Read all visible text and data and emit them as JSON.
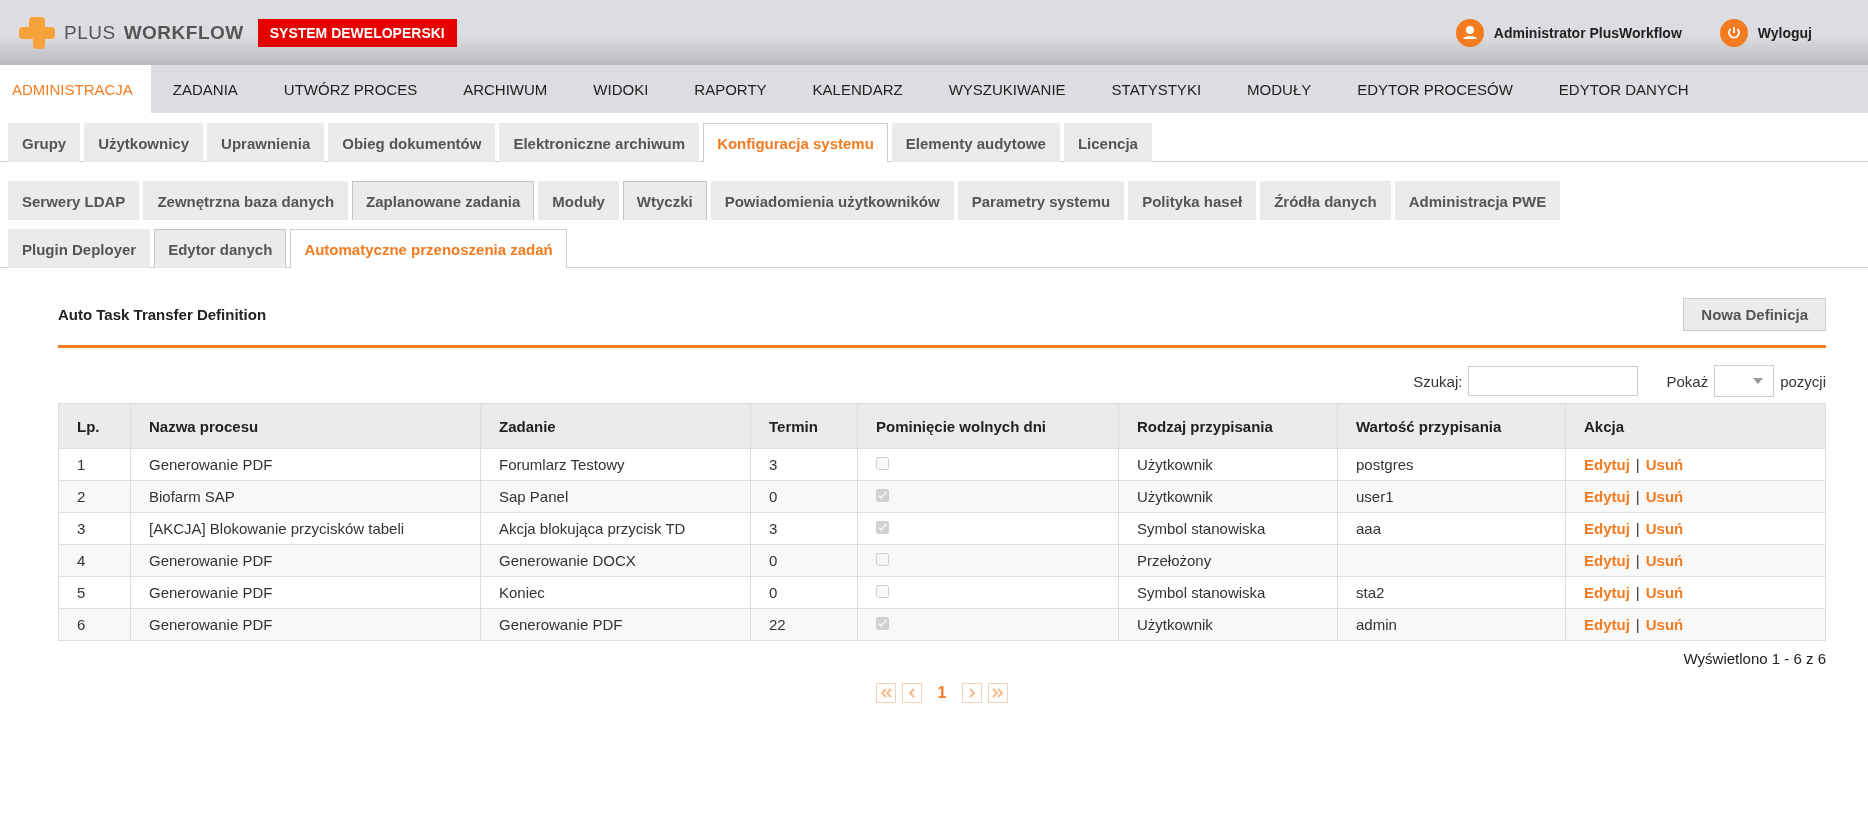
{
  "header": {
    "logo": {
      "part_1": "PLUS",
      "part_2": "WORKFLOW"
    },
    "environment_badge": "SYSTEM DEWELOPERSKI",
    "user": "Administrator PlusWorkflow",
    "logout": "Wyloguj"
  },
  "main_menu": [
    {
      "label": "ADMINISTRACJA",
      "selected": true
    },
    {
      "label": "ZADANIA",
      "selected": false
    },
    {
      "label": "UTWÓRZ PROCES",
      "selected": false
    },
    {
      "label": "ARCHIWUM",
      "selected": false
    },
    {
      "label": "WIDOKI",
      "selected": false
    },
    {
      "label": "RAPORTY",
      "selected": false
    },
    {
      "label": "KALENDARZ",
      "selected": false
    },
    {
      "label": "WYSZUKIWANIE",
      "selected": false
    },
    {
      "label": "STATYSTYKI",
      "selected": false
    },
    {
      "label": "MODUŁY",
      "selected": false
    },
    {
      "label": "EDYTOR PROCESÓW",
      "selected": false
    },
    {
      "label": "EDYTOR DANYCH",
      "selected": false
    }
  ],
  "admin_tabs": [
    {
      "label": "Grupy",
      "selected": false
    },
    {
      "label": "Użytkownicy",
      "selected": false
    },
    {
      "label": "Uprawnienia",
      "selected": false
    },
    {
      "label": "Obieg dokumentów",
      "selected": false
    },
    {
      "label": "Elektroniczne archiwum",
      "selected": false
    },
    {
      "label": "Konfiguracja systemu",
      "selected": true
    },
    {
      "label": "Elementy audytowe",
      "selected": false
    },
    {
      "label": "Licencja",
      "selected": false
    }
  ],
  "config_tabs": [
    [
      {
        "label": "Serwery LDAP",
        "selected": false,
        "outlined": false
      },
      {
        "label": "Zewnętrzna baza danych",
        "selected": false,
        "outlined": false
      },
      {
        "label": "Zaplanowane zadania",
        "selected": false,
        "outlined": true
      },
      {
        "label": "Moduły",
        "selected": false,
        "outlined": false
      },
      {
        "label": "Wtyczki",
        "selected": false,
        "outlined": true
      },
      {
        "label": "Powiadomienia użytkowników",
        "selected": false,
        "outlined": false
      },
      {
        "label": "Parametry systemu",
        "selected": false,
        "outlined": false
      },
      {
        "label": "Polityka haseł",
        "selected": false,
        "outlined": false
      },
      {
        "label": "Źródła danych",
        "selected": false,
        "outlined": false
      },
      {
        "label": "Administracja PWE",
        "selected": false,
        "outlined": false
      }
    ],
    [
      {
        "label": "Plugin Deployer",
        "selected": false,
        "outlined": false
      },
      {
        "label": "Edytor danych",
        "selected": false,
        "outlined": true
      },
      {
        "label": "Automatyczne przenoszenia zadań",
        "selected": true,
        "outlined": false
      }
    ]
  ],
  "panel": {
    "title": "Auto Task Transfer Definition",
    "new_button": "Nowa Definicja"
  },
  "filters": {
    "search_label": "Szukaj:",
    "show_label": "Pokaż",
    "show_suffix": "pozycji"
  },
  "table": {
    "columns": [
      "Lp.",
      "Nazwa procesu",
      "Zadanie",
      "Termin",
      "Pominięcie wolnych dni",
      "Rodzaj przypisania",
      "Wartość przypisania",
      "Akcja"
    ],
    "rows": [
      {
        "lp": "1",
        "process": "Generowanie PDF",
        "task": "Forumlarz Testowy",
        "deadline": "3",
        "skip_free_days": false,
        "assignment_type": "Użytkownik",
        "assignment_value": "postgres",
        "edit": "Edytuj",
        "separator": "|",
        "delete": "Usuń"
      },
      {
        "lp": "2",
        "process": "Biofarm SAP",
        "task": "Sap Panel",
        "deadline": "0",
        "skip_free_days": true,
        "assignment_type": "Użytkownik",
        "assignment_value": "user1",
        "edit": "Edytuj",
        "separator": "|",
        "delete": "Usuń"
      },
      {
        "lp": "3",
        "process": "[AKCJA] Blokowanie przycisków tabeli",
        "task": "Akcja blokująca przycisk TD",
        "deadline": "3",
        "skip_free_days": true,
        "assignment_type": "Symbol stanowiska",
        "assignment_value": "aaa",
        "edit": "Edytuj",
        "separator": "|",
        "delete": "Usuń"
      },
      {
        "lp": "4",
        "process": "Generowanie PDF",
        "task": "Generowanie DOCX",
        "deadline": "0",
        "skip_free_days": false,
        "assignment_type": "Przełożony",
        "edit": "Edytuj",
        "separator": "|",
        "delete": "Usuń"
      },
      {
        "lp": "5",
        "process": "Generowanie PDF",
        "task": "Koniec",
        "deadline": "0",
        "skip_free_days": false,
        "assignment_type": "Symbol stanowiska",
        "assignment_value": "sta2",
        "edit": "Edytuj",
        "separator": "|",
        "delete": "Usuń"
      },
      {
        "lp": "6",
        "process": "Generowanie PDF",
        "task": "Generowanie PDF",
        "deadline": "22",
        "skip_free_days": true,
        "assignment_type": "Użytkownik",
        "assignment_value": "admin",
        "edit": "Edytuj",
        "separator": "|",
        "delete": "Usuń"
      }
    ]
  },
  "summary": "Wyświetlono 1 - 6 z 6",
  "pagination": {
    "current_page": "1"
  }
}
